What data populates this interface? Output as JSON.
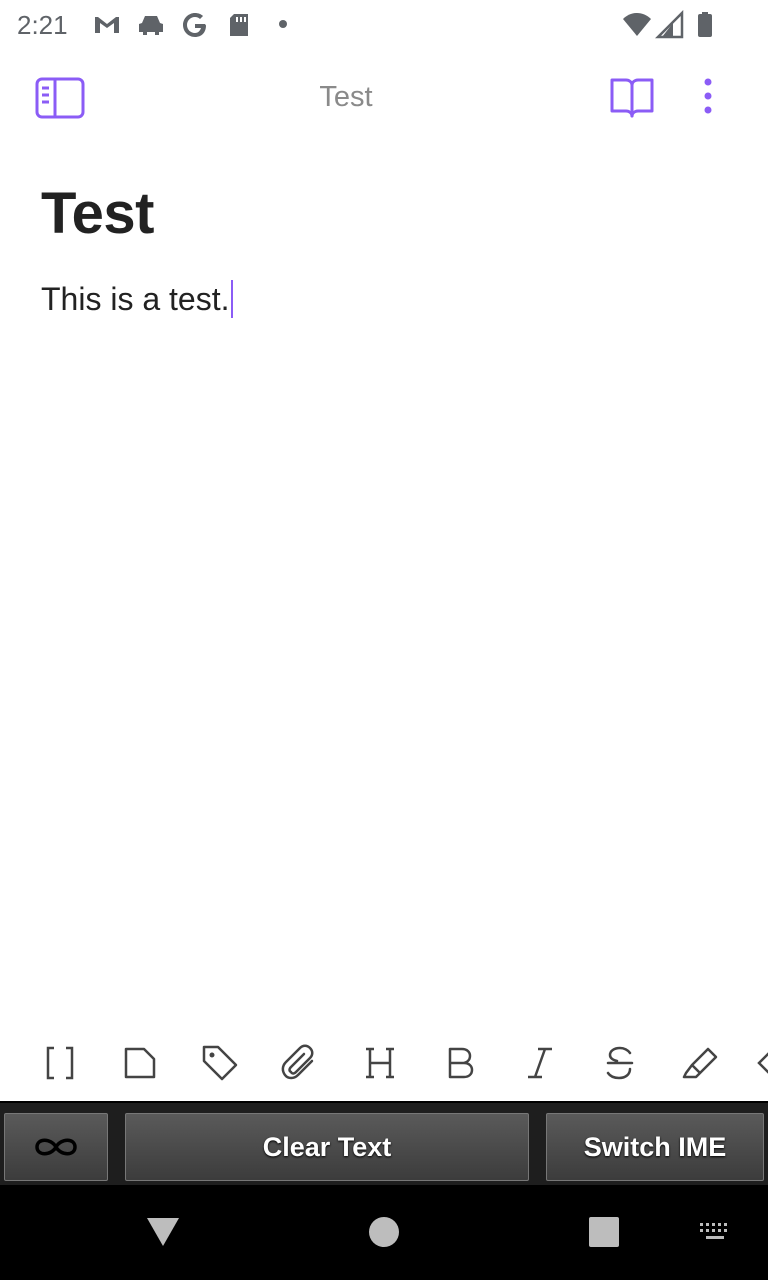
{
  "status_bar": {
    "time": "2:21",
    "icons": [
      "gmail-icon",
      "car-icon",
      "google-icon",
      "sd-card-icon",
      "dot-icon",
      "wifi-icon",
      "signal-icon",
      "battery-icon"
    ]
  },
  "app_bar": {
    "title": "Test",
    "accent_color": "#8b5cf6",
    "left_icon": "sidebar-toggle-icon",
    "right_icons": [
      "reading-mode-icon",
      "more-options-icon"
    ]
  },
  "editor": {
    "heading": "Test",
    "body": "This is a test."
  },
  "format_toolbar": {
    "items": [
      "wikilink-icon",
      "file-icon",
      "tag-icon",
      "attachment-icon",
      "heading-icon",
      "bold-icon",
      "italic-icon",
      "strikethrough-icon",
      "highlight-icon",
      "more-icon"
    ]
  },
  "ime_bar": {
    "left_icon": "infinity-icon",
    "clear_label": "Clear Text",
    "switch_label": "Switch IME"
  },
  "nav_bar": {
    "icons": [
      "back-icon",
      "home-icon",
      "recents-icon",
      "keyboard-icon"
    ]
  }
}
